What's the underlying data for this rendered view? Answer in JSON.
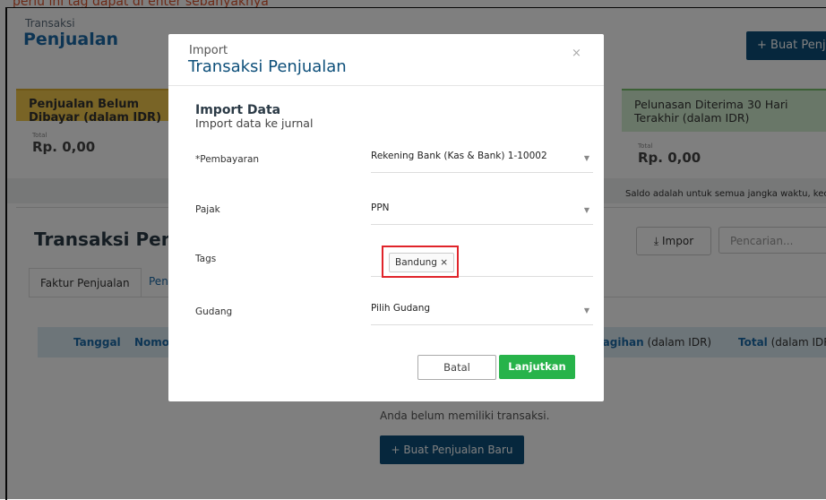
{
  "caption": "perlu ini tag dapat di enter sebanyaknya",
  "header": {
    "crumb": "Transaksi",
    "title": "Penjualan",
    "new_button": "+ Buat Penjualan Baru"
  },
  "cards": {
    "unpaid": {
      "label": "Penjualan Belum Dibayar (dalam IDR)",
      "total_label": "Total",
      "total_value": "Rp. 0,00"
    },
    "received": {
      "label": "Pelunasan Diterima 30 Hari Terakhir (dalam IDR)",
      "total_label": "Total",
      "total_value": "Rp. 0,00",
      "note": "Saldo adalah untuk semua jangka waktu, kecuali ada perubahan"
    }
  },
  "list": {
    "title": "Transaksi Penjualan",
    "tabs": [
      "Faktur Penjualan",
      "Pengiriman"
    ],
    "impor_button": "Impor",
    "search_placeholder": "Pencarian...",
    "columns": [
      {
        "label": "Tanggal",
        "suffix": ""
      },
      {
        "label": "Nomor",
        "suffix": ""
      },
      {
        "label": "Tagihan",
        "suffix": " (dalam IDR)"
      },
      {
        "label": "Total",
        "suffix": " (dalam IDR)"
      }
    ],
    "empty_text": "Anda belum memiliki transaksi.",
    "new_button": "+ Buat Penjualan Baru"
  },
  "modal": {
    "subtitle": "Import",
    "title": "Transaksi Penjualan",
    "close": "×",
    "section_title": "Import Data",
    "section_subtitle": "Import data ke jurnal",
    "fields": {
      "payment": {
        "label": "*Pembayaran",
        "value": "Rekening Bank (Kas & Bank) 1-10002"
      },
      "tax": {
        "label": "Pajak",
        "value": "PPN"
      },
      "tags": {
        "label": "Tags",
        "chip": "Bandung",
        "chip_remove": "×"
      },
      "warehouse": {
        "label": "Gudang",
        "value": "Pilih Gudang"
      }
    },
    "cancel_button": "Batal",
    "continue_button": "Lanjutkan"
  },
  "colors": {
    "brand": "#0d4f7a",
    "link": "#1b6aa8",
    "success": "#27b34a",
    "highlight": "#e0242a"
  }
}
